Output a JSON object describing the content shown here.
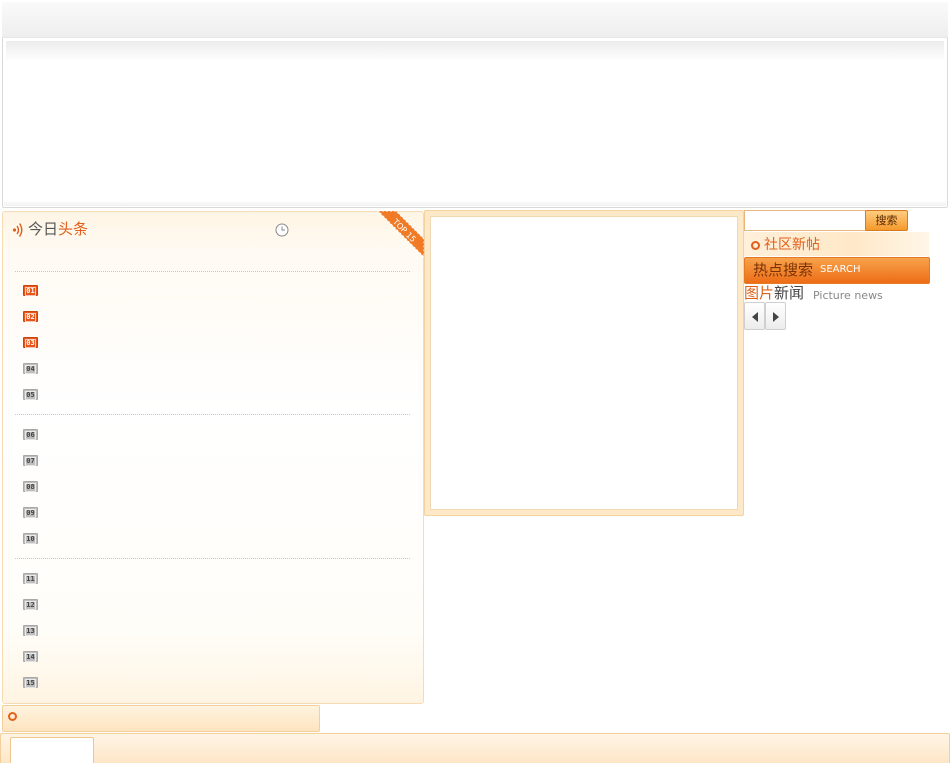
{
  "headlines": {
    "title_part1": "今日",
    "title_part2": "头条",
    "badge": "TOP 15",
    "ranks": [
      "01",
      "02",
      "03",
      "04",
      "05",
      "06",
      "07",
      "08",
      "09",
      "10",
      "11",
      "12",
      "13",
      "14",
      "15"
    ],
    "hot_ranks_count": 3,
    "icons": {
      "title": "signal-icon",
      "clock": "clock-icon"
    }
  },
  "colors": {
    "accent": "#e0601a",
    "panel_bg": "#fff5e5",
    "border": "#f7dbb4"
  },
  "search": {
    "button_label": "搜索",
    "placeholder": ""
  },
  "community": {
    "title": "社区新帖"
  },
  "hot_search": {
    "title": "热点搜索",
    "subtitle": "SEARCH"
  },
  "picture_news": {
    "title_part1": "图片",
    "title_part2": "新闻",
    "subtitle": "Picture news"
  }
}
